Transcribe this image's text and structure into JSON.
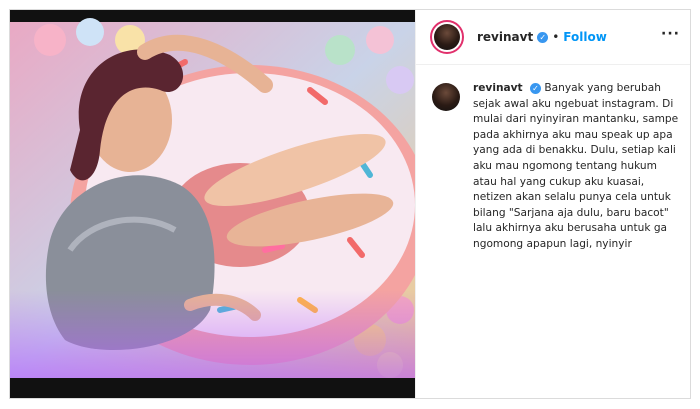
{
  "post": {
    "username": "revinavt",
    "follow_label": "Follow",
    "dot": "•",
    "more_label": "···",
    "verified_symbol": "✓",
    "caption_lines": [
      "Banyak yang berubah",
      "sejak awal aku ngebuat instagram. Di",
      "mulai dari nyinyiran mantanku, sampe",
      "pada akhirnya aku mau speak up apa",
      "yang ada di benakku. Dulu, setiap kali",
      "aku mau ngomong tentang hukum",
      "atau hal yang cukup aku kuasai,",
      "netizen akan selalu punya cela untuk",
      "bilang \"Sarjana aja dulu, baru bacot\"",
      "lalu akhirnya aku berusaha untuk ga",
      "ngomong apapun lagi, nyinyir"
    ]
  },
  "colors": {
    "follow": "#0095f6",
    "verified": "#3897f0",
    "story_ring": "#e1306c"
  }
}
